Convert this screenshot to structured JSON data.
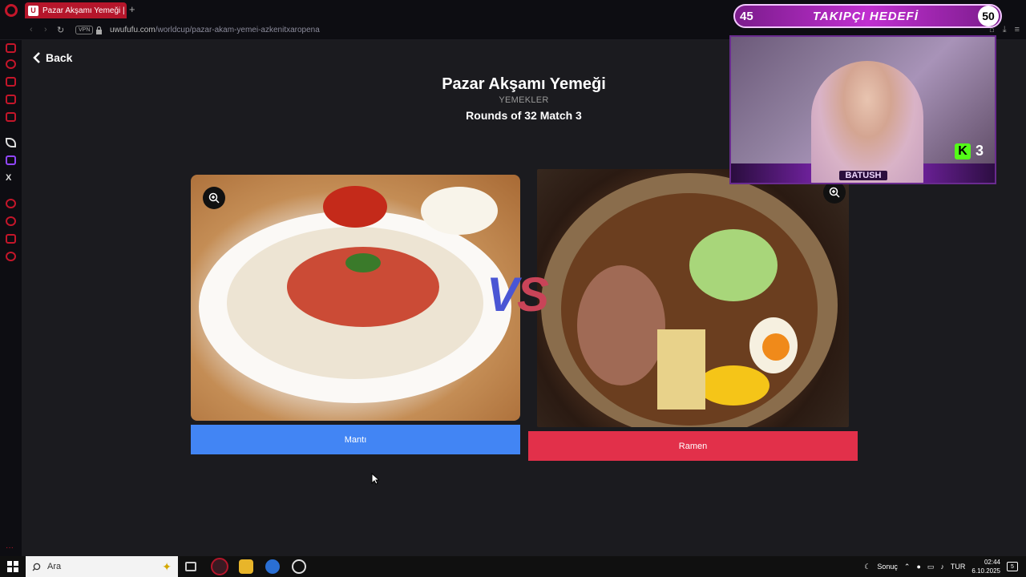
{
  "browser": {
    "tab_title": "Pazar Akşamı Yemeği | Uw",
    "tab_favicon": "U",
    "new_tab": "+",
    "vpn_label": "VPN",
    "url_host": "uwufufu.com",
    "url_path": "/worldcup/pazar-akam-yemei-azkenitxaropena"
  },
  "page": {
    "back_label": "Back",
    "title": "Pazar Akşamı Yemeği",
    "category": "YEMEKLER",
    "round": "Rounds of 32 Match 3",
    "vs": {
      "v": "V",
      "s": "S"
    },
    "left_choice": "Mantı",
    "right_choice": "Ramen"
  },
  "overlay": {
    "goal_current": "45",
    "goal_label": "TAKIPÇI HEDEFİ",
    "goal_target": "50",
    "streamer_name": "BATUSH",
    "kick_letter": "K",
    "kick_count": "3"
  },
  "taskbar": {
    "search_placeholder": "Ara",
    "weather_label": "Sonuç",
    "language": "TUR",
    "time": "02:44",
    "date": "6.10.2025",
    "notification_count": "5"
  },
  "colors": {
    "accent": "#c4162a",
    "left_button": "#4285f4",
    "right_button": "#e2304a",
    "vs_v": "#4a56d4",
    "vs_s": "#c94458",
    "goal_bar": "#c02fd0",
    "kick_green": "#53fc18"
  },
  "icons": {
    "sidebar": [
      "messenger-icon",
      "refresh-icon",
      "bag-icon",
      "chat-icon",
      "music-icon",
      "aria-icon",
      "twitch-icon",
      "x-icon",
      "circle-icon",
      "history-icon",
      "extensions-icon",
      "settings-icon"
    ]
  }
}
